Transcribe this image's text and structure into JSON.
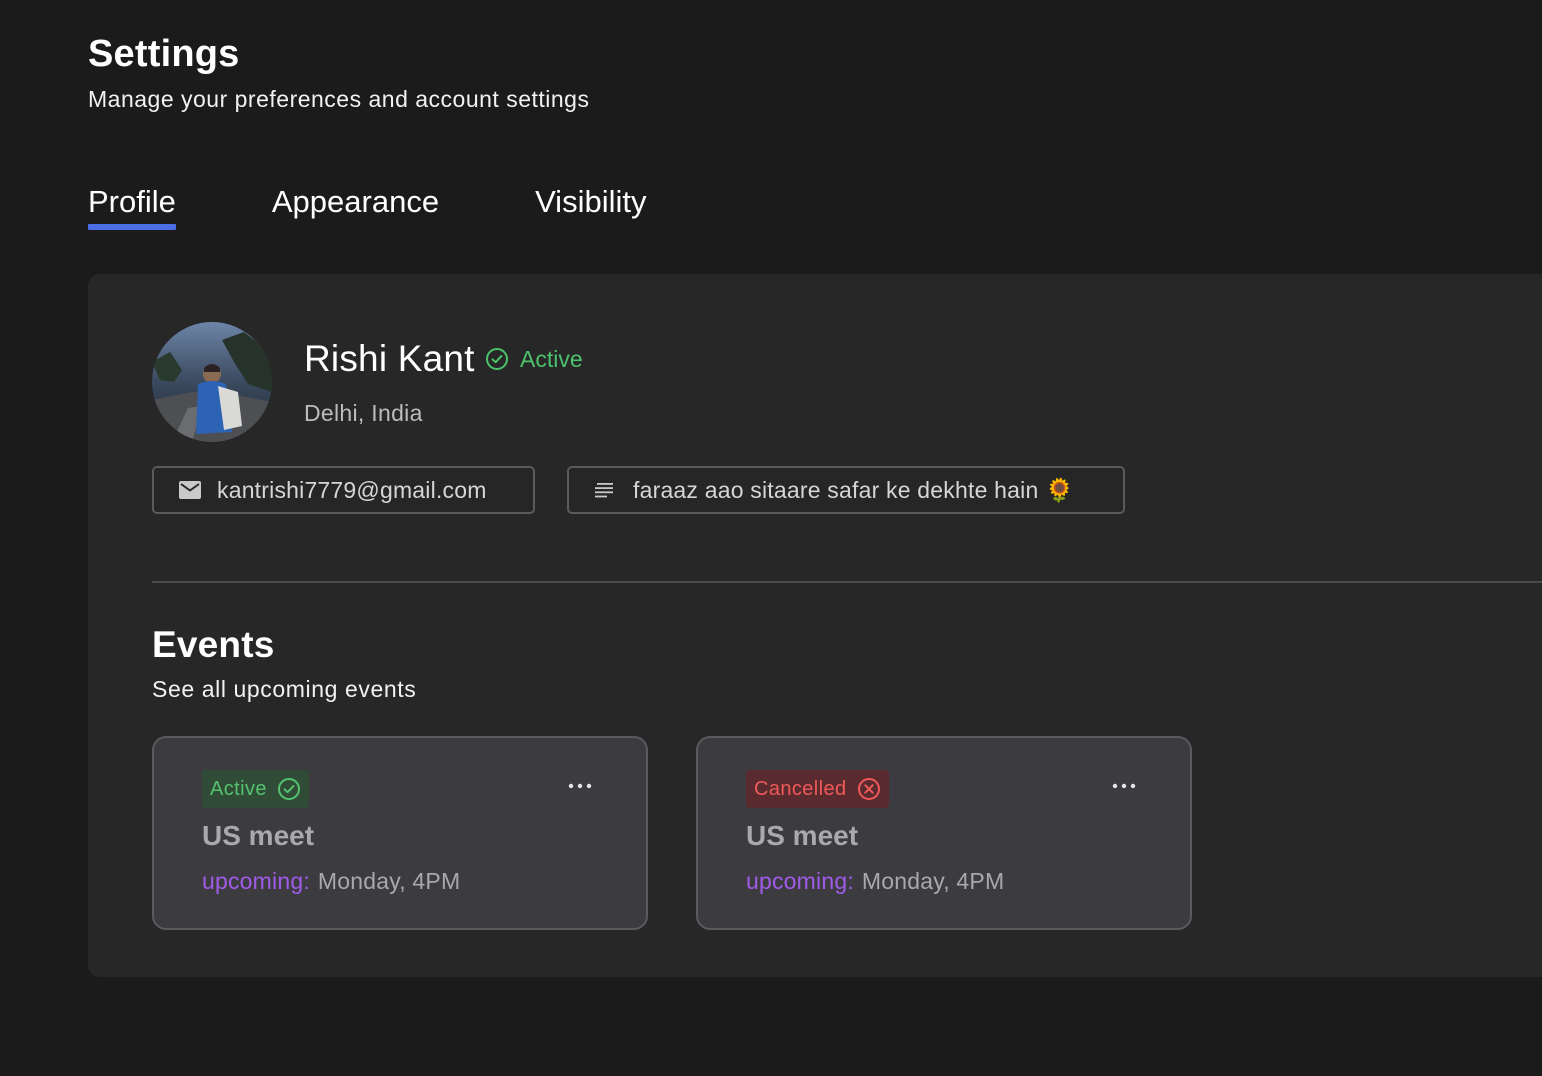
{
  "header": {
    "title": "Settings",
    "subtitle": "Manage your preferences and account settings"
  },
  "tabs": [
    {
      "label": "Profile",
      "active": true
    },
    {
      "label": "Appearance",
      "active": false
    },
    {
      "label": "Visibility",
      "active": false
    }
  ],
  "profile": {
    "name": "Rishi Kant",
    "status": "Active",
    "location": "Delhi, India",
    "email": "kantrishi7779@gmail.com",
    "bio": "faraaz aao sitaare safar ke dekhte hain 🌻",
    "icons": {
      "status": "check-circle-icon",
      "email": "mail-icon",
      "bio": "text-lines-icon"
    }
  },
  "events": {
    "title": "Events",
    "subtitle": "See all upcoming events",
    "cards": [
      {
        "status": "Active",
        "status_icon": "check-circle-icon",
        "title": "US meet",
        "upcoming_label": "upcoming:",
        "when": "Monday, 4PM"
      },
      {
        "status": "Cancelled",
        "status_icon": "x-circle-icon",
        "title": "US meet",
        "upcoming_label": "upcoming:",
        "when": "Monday, 4PM"
      }
    ]
  },
  "colors": {
    "background": "#1b1b1c",
    "panel": "#272728",
    "card": "#3b3b40",
    "accent_tab": "#4b6ee6",
    "active_green": "#4cc26a",
    "cancelled_red": "#ef5959",
    "upcoming_purple": "#a25be8"
  }
}
